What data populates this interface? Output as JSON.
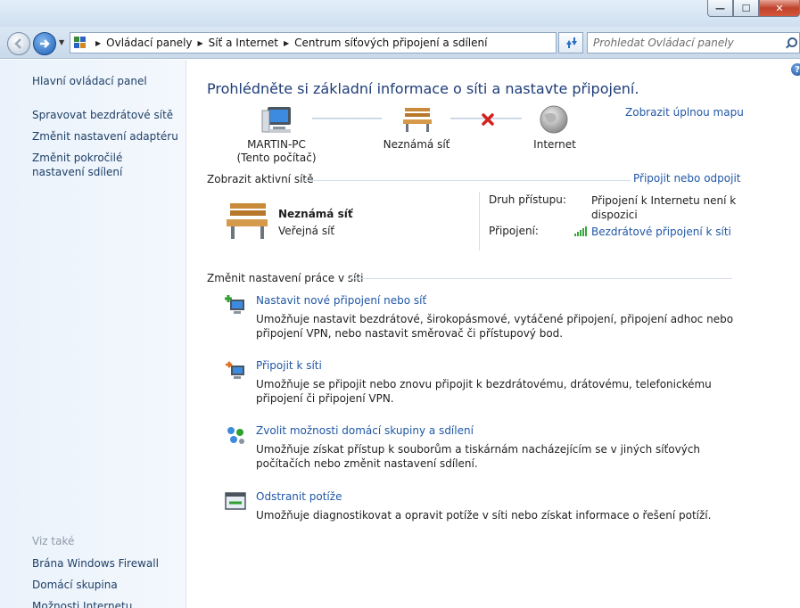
{
  "window": {
    "minimize_label": "—",
    "maximize_label": "☐",
    "close_label": "✕"
  },
  "address": {
    "crumbs": [
      "Ovládací panely",
      "Síť a Internet",
      "Centrum síťových připojení a sdílení"
    ],
    "search_placeholder": "Prohledat Ovládací panely"
  },
  "sidebar": {
    "home": "Hlavní ovládací panel",
    "items": [
      "Spravovat bezdrátové sítě",
      "Změnit nastavení adaptéru",
      "Změnit pokročilé nastavení sdílení"
    ],
    "see_also_title": "Viz také",
    "see_also": [
      "Brána Windows Firewall",
      "Domácí skupina",
      "Možnosti Internetu"
    ]
  },
  "main": {
    "title": "Prohlédněte si základní informace o síti a nastavte připojení.",
    "full_map_link": "Zobrazit úplnou mapu",
    "map": {
      "computer_name": "MARTIN-PC",
      "computer_sub": "(Tento počítač)",
      "network_name": "Neznámá síť",
      "internet": "Internet"
    },
    "active_networks": {
      "header": "Zobrazit aktivní sítě",
      "connect_link": "Připojit nebo odpojit",
      "network_name": "Neznámá síť",
      "network_type": "Veřejná síť",
      "access_label": "Druh přístupu:",
      "access_value": "Připojení k Internetu není k dispozici",
      "connection_label": "Připojení:",
      "connection_value": "Bezdrátové připojení k síti"
    },
    "change_settings": {
      "header": "Změnit nastavení práce v síti",
      "tasks": [
        {
          "link": "Nastavit nové připojení nebo síť",
          "desc": "Umožňuje nastavit bezdrátové, širokopásmové, vytáčené připojení, připojení adhoc nebo připojení VPN, nebo nastavit směrovač či přístupový bod."
        },
        {
          "link": "Připojit k síti",
          "desc": "Umožňuje se připojit nebo znovu připojit k bezdrátovému, drátovému, telefonickému připojení či připojení VPN."
        },
        {
          "link": "Zvolit možnosti domácí skupiny a sdílení",
          "desc": "Umožňuje získat přístup k souborům a tiskárnám nacházejícím se v jiných síťových počítačích nebo změnit nastavení sdílení."
        },
        {
          "link": "Odstranit potíže",
          "desc": "Umožňuje diagnostikovat a opravit potíže v síti nebo získat informace o řešení potíží."
        }
      ]
    }
  }
}
